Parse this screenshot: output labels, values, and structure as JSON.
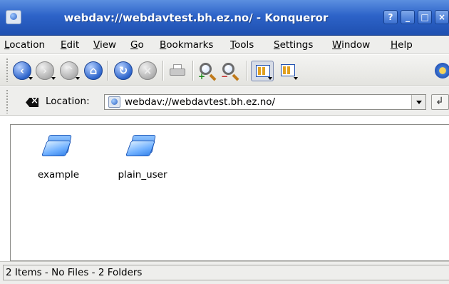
{
  "window": {
    "title": "webdav://webdavtest.bh.ez.no/ - Konqueror",
    "buttons": {
      "help": "?",
      "minimize": "_",
      "maximize": "□",
      "close": "×"
    }
  },
  "menubar": {
    "items": [
      {
        "label": "Location",
        "underline": "L"
      },
      {
        "label": "Edit",
        "underline": "E"
      },
      {
        "label": "View",
        "underline": "V"
      },
      {
        "label": "Go",
        "underline": "G"
      },
      {
        "label": "Bookmarks",
        "underline": "B"
      },
      {
        "label": "Tools",
        "underline": "T"
      },
      {
        "label": "Settings",
        "underline": "S"
      },
      {
        "label": "Window",
        "underline": "W"
      },
      {
        "label": "Help",
        "underline": "H"
      }
    ]
  },
  "toolbar": {
    "icons": [
      "back-icon",
      "forward-icon",
      "up-icon",
      "home-icon",
      "reload-icon",
      "stop-icon",
      "print-icon",
      "zoom-in-icon",
      "zoom-out-icon",
      "icon-view-icon",
      "tree-view-icon",
      "gear-icon"
    ]
  },
  "location_bar": {
    "label": "Location:",
    "url": "webdav://webdavtest.bh.ez.no/"
  },
  "files": [
    {
      "name": "example",
      "type": "folder"
    },
    {
      "name": "plain_user",
      "type": "folder"
    }
  ],
  "status": {
    "text": "2 Items - No Files - 2 Folders"
  }
}
